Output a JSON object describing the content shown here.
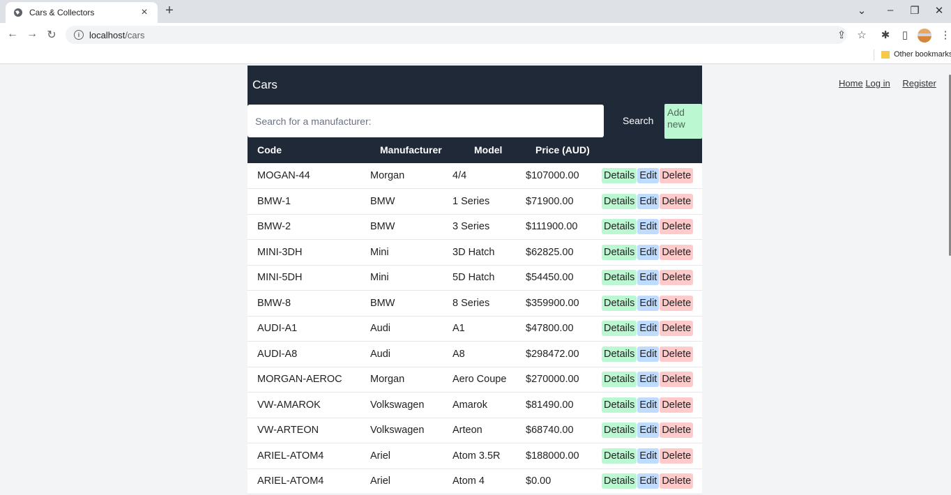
{
  "browser": {
    "tab_title": "Cars & Collectors",
    "tab_close": "×",
    "new_tab": "+",
    "url_host": "localhost",
    "url_path": "/cars",
    "bookmarks_label": "Other bookmarks"
  },
  "nav": {
    "home": "Home",
    "login": "Log in",
    "register": "Register"
  },
  "panel": {
    "title": "Cars",
    "search_placeholder": "Search for a manufacturer:",
    "search_label": "Search",
    "add_label": "Add new"
  },
  "columns": [
    "Code",
    "Manufacturer",
    "Model",
    "Price (AUD)"
  ],
  "actions": {
    "details": "Details",
    "edit": "Edit",
    "delete": "Delete"
  },
  "rows": [
    {
      "code": "MOGAN-44",
      "manufacturer": "Morgan",
      "model": "4/4",
      "price": "$107000.00"
    },
    {
      "code": "BMW-1",
      "manufacturer": "BMW",
      "model": "1 Series",
      "price": "$71900.00"
    },
    {
      "code": "BMW-2",
      "manufacturer": "BMW",
      "model": "3 Series",
      "price": "$111900.00"
    },
    {
      "code": "MINI-3DH",
      "manufacturer": "Mini",
      "model": "3D Hatch",
      "price": "$62825.00"
    },
    {
      "code": "MINI-5DH",
      "manufacturer": "Mini",
      "model": "5D Hatch",
      "price": "$54450.00"
    },
    {
      "code": "BMW-8",
      "manufacturer": "BMW",
      "model": "8 Series",
      "price": "$359900.00"
    },
    {
      "code": "AUDI-A1",
      "manufacturer": "Audi",
      "model": "A1",
      "price": "$47800.00"
    },
    {
      "code": "AUDI-A8",
      "manufacturer": "Audi",
      "model": "A8",
      "price": "$298472.00"
    },
    {
      "code": "MORGAN-AEROC",
      "manufacturer": "Morgan",
      "model": "Aero Coupe",
      "price": "$270000.00"
    },
    {
      "code": "VW-AMAROK",
      "manufacturer": "Volkswagen",
      "model": "Amarok",
      "price": "$81490.00"
    },
    {
      "code": "VW-ARTEON",
      "manufacturer": "Volkswagen",
      "model": "Arteon",
      "price": "$68740.00"
    },
    {
      "code": "ARIEL-ATOM4",
      "manufacturer": "Ariel",
      "model": "Atom 3.5R",
      "price": "$188000.00"
    },
    {
      "code": "ARIEL-ATOM4",
      "manufacturer": "Ariel",
      "model": "Atom 4",
      "price": "$0.00"
    }
  ],
  "colors": {
    "panel_bg": "#1f2937",
    "details_bg": "#bbf7d0",
    "edit_bg": "#bfdbfe",
    "delete_bg": "#fecaca"
  }
}
